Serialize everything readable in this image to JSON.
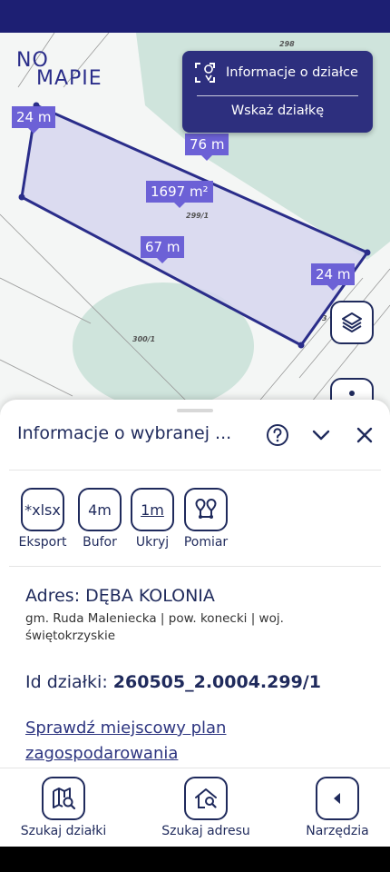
{
  "logo": {
    "line1": "NO",
    "line2": "MAPIE"
  },
  "info_card": {
    "title": "Informacje o działce",
    "action": "Wskaż działkę"
  },
  "map": {
    "labels": {
      "top_left": "24 m",
      "top": "76 m",
      "area": "1697 m²",
      "bottom": "67 m",
      "right": "24 m"
    },
    "parcels": {
      "p298": "298",
      "p299": "299/1",
      "p300": "300/1",
      "p3": "3"
    }
  },
  "sheet": {
    "title": "Informacje o wybranej ...",
    "tools": [
      {
        "icon_text": "*xlsx",
        "label": "Eksport"
      },
      {
        "icon_text": "4m",
        "label": "Bufor"
      },
      {
        "icon_text": "1m",
        "label": "Ukryj"
      },
      {
        "icon_text": "",
        "label": "Pomiar"
      }
    ],
    "address": "Adres: DĘBA KOLONIA",
    "address_sub": "gm. Ruda Maleniecka | pow. konecki | woj. świętokrzyskie",
    "parcel_id_label": "Id działki: ",
    "parcel_id_value": "260505_2.0004.299/1",
    "link": "Sprawdź miejscowy plan zagospodarowania"
  },
  "nav": [
    {
      "label": "Szukaj działki",
      "icon": "map-search-icon"
    },
    {
      "label": "Szukaj adresu",
      "icon": "home-search-icon"
    },
    {
      "label": "Narzędzia",
      "icon": "chevron-left-icon"
    }
  ],
  "colors": {
    "primary": "#1f2a5c",
    "card": "#2d2f7e",
    "label": "#6c61d6",
    "parcel_fill": "#d6d6ef",
    "green": "#cfe4dc"
  }
}
